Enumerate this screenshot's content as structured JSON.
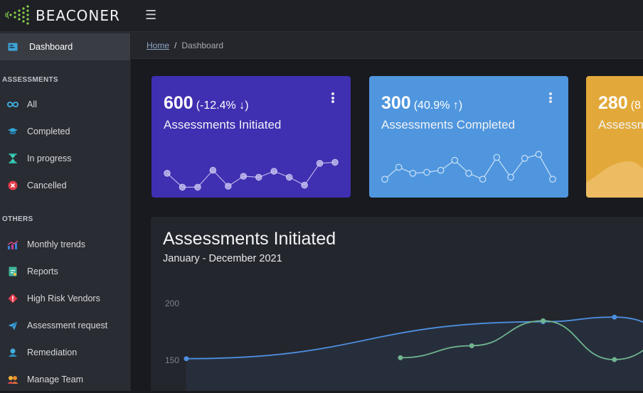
{
  "app": {
    "brand": "BEACONER",
    "menu_icon": "hamburger-icon"
  },
  "breadcrumb": {
    "home": "Home",
    "separator": "/",
    "current": "Dashboard"
  },
  "sidebar": {
    "dashboard": {
      "label": "Dashboard",
      "icon": "dashboard-icon"
    },
    "assessments_heading": "ASSESSMENTS",
    "assessments": [
      {
        "label": "All",
        "icon": "infinity-icon"
      },
      {
        "label": "Completed",
        "icon": "graduation-cap-icon"
      },
      {
        "label": "In progress",
        "icon": "hourglass-icon"
      },
      {
        "label": "Cancelled",
        "icon": "cancel-icon"
      }
    ],
    "others_heading": "OTHERS",
    "others": [
      {
        "label": "Monthly trends",
        "icon": "trend-chart-icon"
      },
      {
        "label": "Reports",
        "icon": "report-icon"
      },
      {
        "label": "High Risk Vendors",
        "icon": "warning-diamond-icon"
      },
      {
        "label": "Assessment request",
        "icon": "paper-plane-icon"
      },
      {
        "label": "Remediation",
        "icon": "remediation-icon"
      },
      {
        "label": "Manage Team",
        "icon": "team-icon"
      }
    ]
  },
  "cards": [
    {
      "value": "600",
      "change": "(-12.4% ↓)",
      "label": "Assessments Initiated",
      "color": "#3f2fb1",
      "spark": [
        38,
        24,
        24,
        41,
        25,
        35,
        34,
        40,
        34,
        26,
        48,
        49
      ]
    },
    {
      "value": "300",
      "change": "(40.9% ↑)",
      "label": "Assessments Completed",
      "color": "#4f96de",
      "spark": [
        32,
        44,
        38,
        39,
        41,
        51,
        38,
        32,
        54,
        34,
        53,
        57,
        32
      ]
    },
    {
      "value": "280",
      "change": "(8",
      "label": "Assessm",
      "color": "#e2a93a"
    }
  ],
  "main_chart": {
    "title": "Assessments Initiated",
    "subtitle": "January - December 2021"
  },
  "chart_data": {
    "type": "line",
    "title": "Assessments Initiated",
    "subtitle": "January - December 2021",
    "y_ticks": [
      "200",
      "150"
    ],
    "ylim": [
      110,
      210
    ],
    "series": [
      {
        "color": "#4d8fe0",
        "x": [
          0,
          5,
          6,
          7.1
        ],
        "values": [
          141,
          181,
          186,
          165
        ]
      },
      {
        "color": "#6fb58f",
        "x": [
          3,
          4,
          5,
          6,
          7.1
        ],
        "values": [
          142,
          155,
          182,
          140,
          180
        ]
      }
    ]
  },
  "colors": {
    "accent_blue": "#4d8fe0",
    "accent_green": "#6fb58f",
    "card_purple": "#3f2fb1",
    "card_blue": "#4f96de",
    "card_orange": "#e2a93a"
  }
}
